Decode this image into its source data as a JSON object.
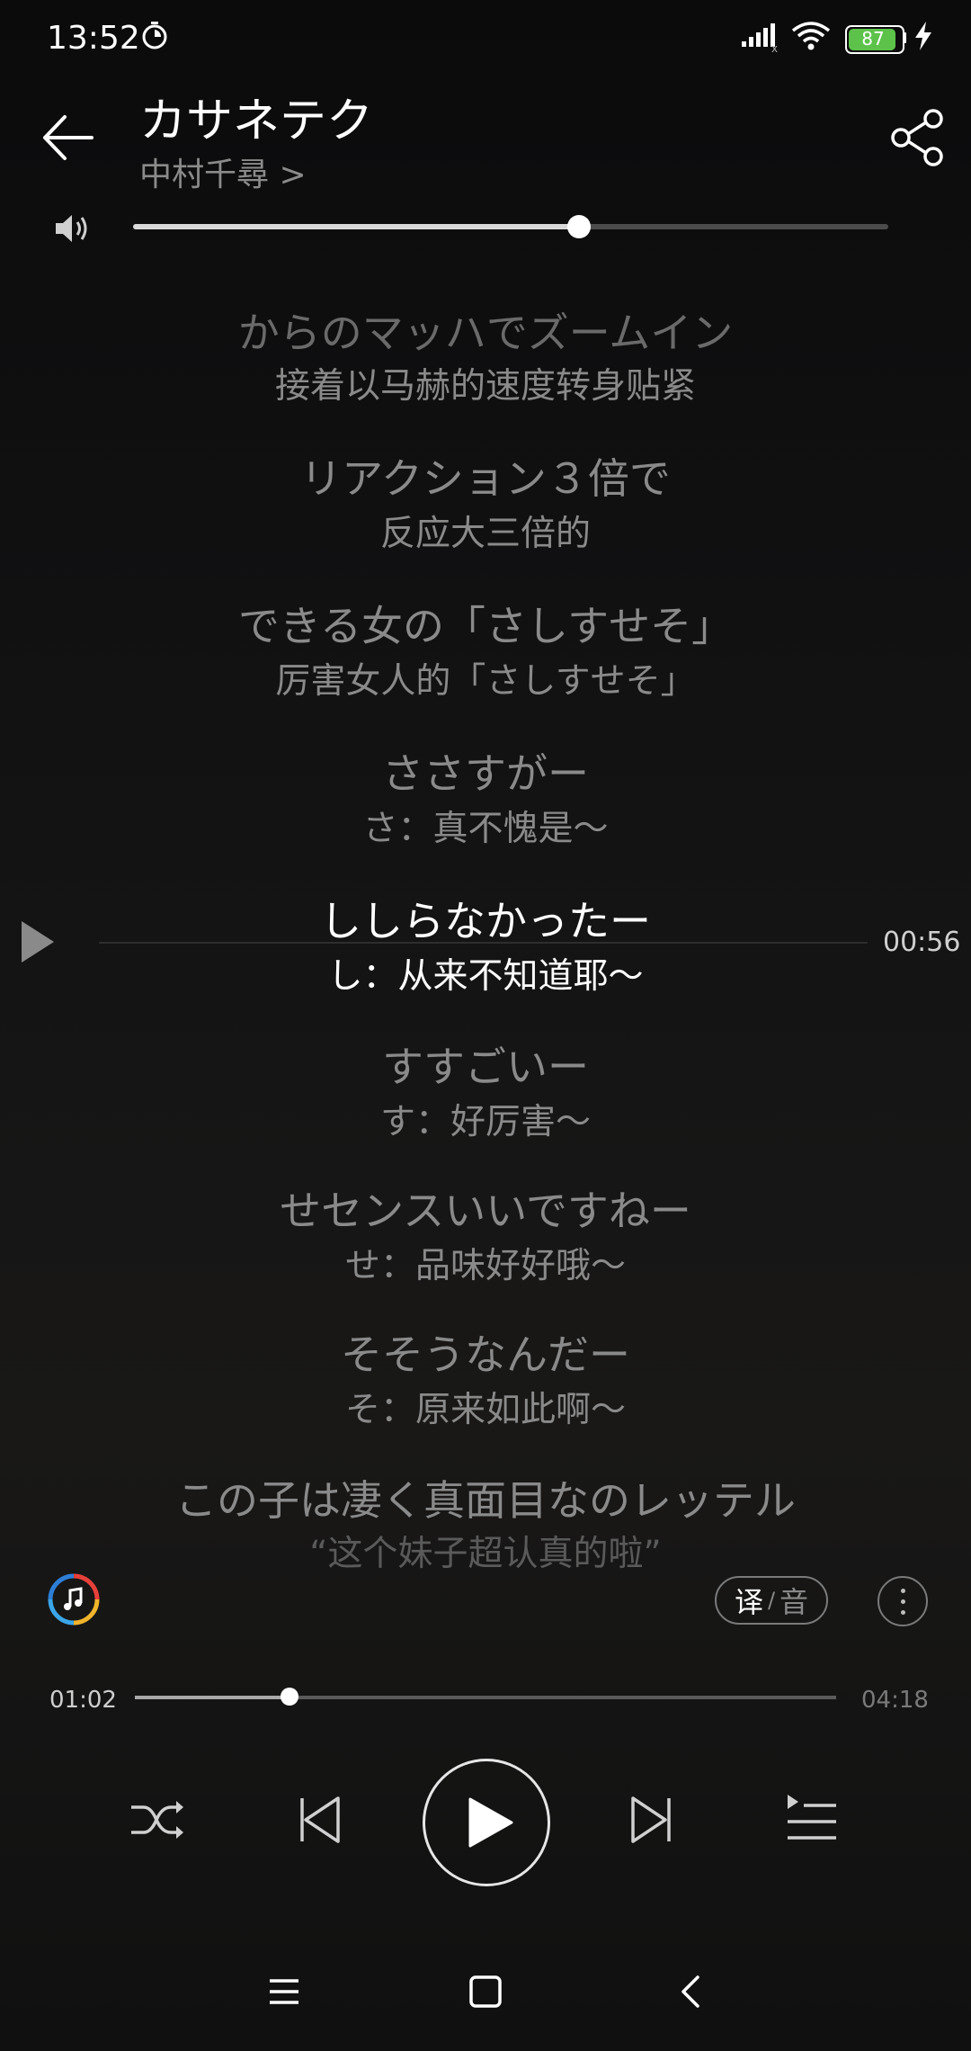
{
  "status_bar": {
    "time": "13:52",
    "battery": "87"
  },
  "header": {
    "title": "カサネテク",
    "artist": "中村千尋 >"
  },
  "volume": {
    "level": 0.59
  },
  "lyrics": [
    {
      "jp": "からのマッハでズームイン",
      "cn": "接着以马赫的速度转身贴紧"
    },
    {
      "jp": "リアクション３倍で",
      "cn": "反应大三倍的"
    },
    {
      "jp": "できる女の「さしすせそ」",
      "cn": "厉害女人的「さしすせそ」"
    },
    {
      "jp": "ささすがー",
      "cn": "さ：真不愧是～"
    },
    {
      "jp": "ししらなかったー",
      "cn": "し：从来不知道耶～"
    },
    {
      "jp": "すすごいー",
      "cn": "す：好厉害～"
    },
    {
      "jp": "せセンスいいですねー",
      "cn": "せ：品味好好哦～"
    },
    {
      "jp": "そそうなんだー",
      "cn": "そ：原来如此啊～"
    },
    {
      "jp": "この子は凄く真面目なのレッテル",
      "cn": "“这个妹子超认真的啦”"
    }
  ],
  "seek": {
    "time": "00:56"
  },
  "translate_toggle": {
    "a": "译",
    "sep": "/",
    "b": "音"
  },
  "playback": {
    "current": "01:02",
    "total": "04:18",
    "progress": 0.22
  }
}
